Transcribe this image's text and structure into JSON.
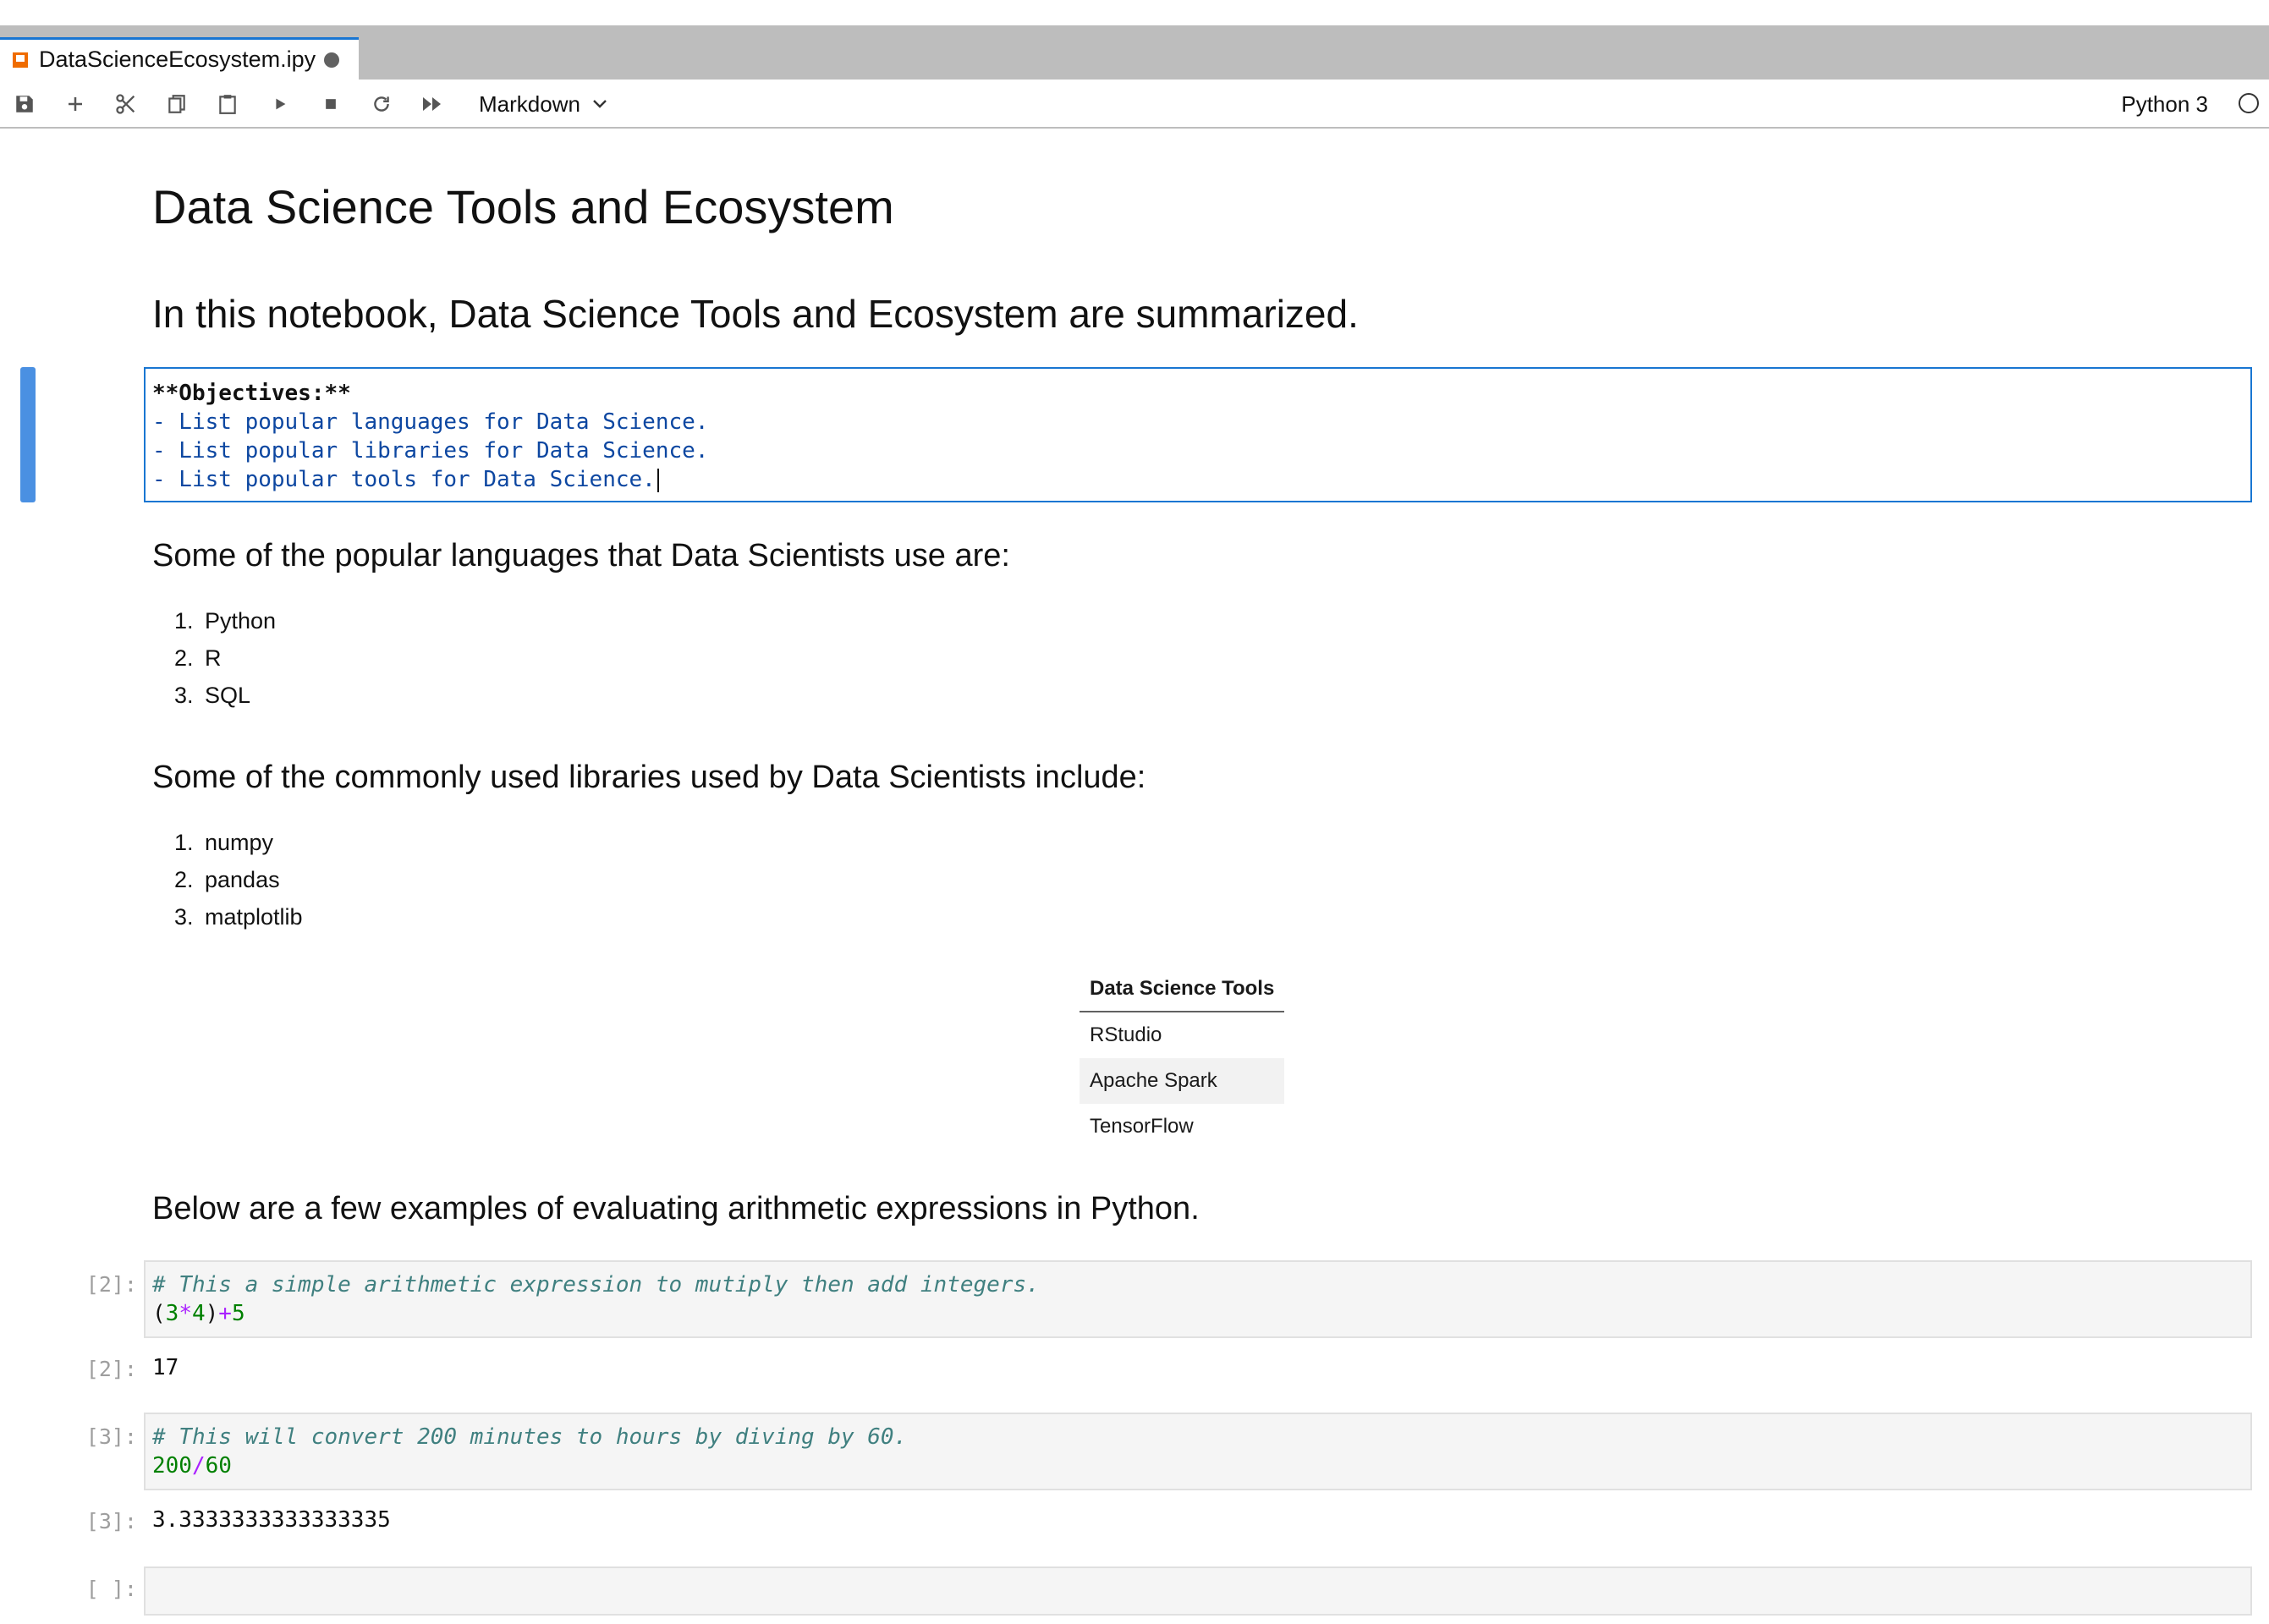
{
  "tab": {
    "title": "DataScienceEcosystem.ipy"
  },
  "toolbar": {
    "cell_type": "Markdown",
    "kernel": "Python 3"
  },
  "cells": {
    "title": "Data Science Tools and Ecosystem",
    "intro": "In this notebook, Data Science Tools and Ecosystem are summarized.",
    "objectives_source": [
      "**Objectives:**",
      "- List popular languages for Data Science.",
      "- List popular libraries for Data Science.",
      "- List popular tools for Data Science."
    ],
    "languages_heading": "Some of the popular languages that Data Scientists use are:",
    "languages": [
      "Python",
      "R",
      "SQL"
    ],
    "libraries_heading": "Some of the commonly used libraries used by Data Scientists include:",
    "libraries": [
      "numpy",
      "pandas",
      "matplotlib"
    ],
    "tools_table": {
      "header": "Data Science Tools",
      "rows": [
        "RStudio",
        "Apache Spark",
        "TensorFlow"
      ]
    },
    "arith_heading": "Below are a few examples of evaluating arithmetic expressions in Python.",
    "code1": {
      "prompt_in": "[2]:",
      "comment": "# This a simple arithmetic expression to mutiply then add integers.",
      "t1": "(",
      "n1": "3",
      "op1": "*",
      "n2": "4",
      "t2": ")",
      "op2": "+",
      "n3": "5",
      "prompt_out": "[2]:",
      "output": "17"
    },
    "code2": {
      "prompt_in": "[3]:",
      "comment": "# This will convert 200 minutes to hours by diving by 60.",
      "n1": "200",
      "op1": "/",
      "n2": "60",
      "prompt_out": "[3]:",
      "output": "3.3333333333333335"
    },
    "empty_prompt": "[ ]:"
  },
  "colors": {
    "accent": "#1976d2",
    "active_cell_bar": "#4a90e2"
  }
}
